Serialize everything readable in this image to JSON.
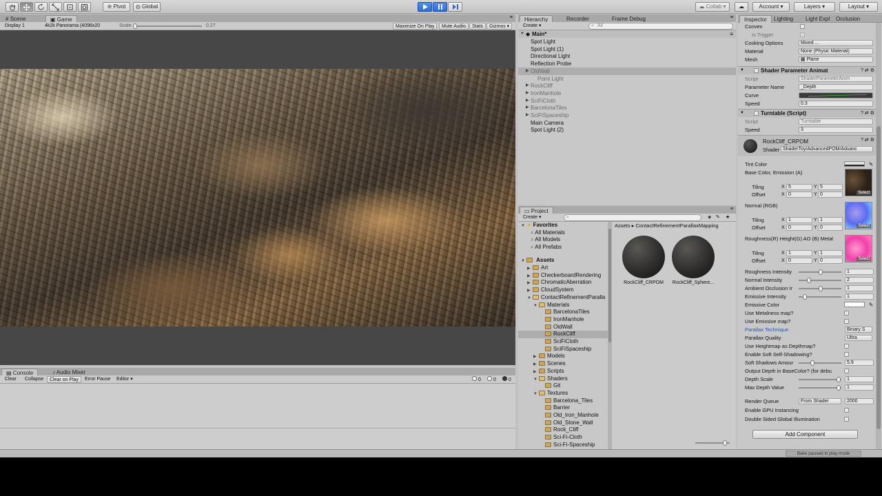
{
  "toolbar": {
    "pivot": "Pivot",
    "global": "Global",
    "collab": "Collab ▾",
    "account": "Account ▾",
    "layers": "Layers ▾",
    "layout": "Layout ▾"
  },
  "viewtabs": {
    "scene": "Scene",
    "game": "Game"
  },
  "gamebar": {
    "display": "Display 1",
    "resolution": "4k2k Panorama (4096x20",
    "scale_label": "Scale",
    "scale_value": "0.27",
    "maximize": "Maximize On Play",
    "mute": "Mute Audio",
    "stats": "Stats",
    "gizmos": "Gizmos ▾"
  },
  "console": {
    "tab_console": "Console",
    "tab_mixer": "Audio Mixer",
    "clear": "Clear",
    "collapse": "Collapse",
    "clear_on_play": "Clear on Play",
    "error_pause": "Error Pause",
    "editor": "Editor ▾",
    "count_log": "0",
    "count_warn": "0",
    "count_err": "0"
  },
  "hierarchy": {
    "tabs": [
      "Hierarchy",
      "Recorder (expe",
      "Frame Debug"
    ],
    "create": "Create ▾",
    "search_placeholder": "All",
    "scene_name": "Main*",
    "items": [
      {
        "label": "Spot Light",
        "indent": 0,
        "arrow": false,
        "dim": false,
        "selected": false
      },
      {
        "label": "Spot Light (1)",
        "indent": 0,
        "arrow": false,
        "dim": false,
        "selected": false
      },
      {
        "label": "Directional Light",
        "indent": 0,
        "arrow": false,
        "dim": false,
        "selected": false
      },
      {
        "label": "Reflection Probe",
        "indent": 0,
        "arrow": false,
        "dim": false,
        "selected": false
      },
      {
        "label": "OldWall",
        "indent": 0,
        "arrow": true,
        "dim": true,
        "selected": true
      },
      {
        "label": "Point Light",
        "indent": 1,
        "arrow": false,
        "dim": true,
        "selected": false
      },
      {
        "label": "RockCliff",
        "indent": 0,
        "arrow": true,
        "dim": true,
        "selected": false
      },
      {
        "label": "IronManhole",
        "indent": 0,
        "arrow": true,
        "dim": true,
        "selected": false
      },
      {
        "label": "SciFiCloth",
        "indent": 0,
        "arrow": true,
        "dim": true,
        "selected": false
      },
      {
        "label": "BarcelonaTiles",
        "indent": 0,
        "arrow": true,
        "dim": true,
        "selected": false
      },
      {
        "label": "SciFiSpaceship",
        "indent": 0,
        "arrow": true,
        "dim": true,
        "selected": false
      },
      {
        "label": "Main Camera",
        "indent": 0,
        "arrow": false,
        "dim": false,
        "selected": false
      },
      {
        "label": "Spot Light (2)",
        "indent": 0,
        "arrow": false,
        "dim": false,
        "selected": false
      }
    ]
  },
  "project": {
    "tab": "Project",
    "create": "Create ▾",
    "breadcrumb_root": "Assets",
    "breadcrumb_sep": "▸",
    "breadcrumb_leaf": "ContactRefinementParallaxMapping",
    "favorites_label": "Favorites",
    "favorites": [
      "All Materials",
      "All Models",
      "All Prefabs"
    ],
    "assets_label": "Assets",
    "tree": [
      {
        "label": "Art",
        "level": 1,
        "open": false,
        "selected": false
      },
      {
        "label": "CheckerboardRendering",
        "level": 1,
        "open": false,
        "selected": false
      },
      {
        "label": "ChromaticAberration",
        "level": 1,
        "open": false,
        "selected": false
      },
      {
        "label": "CloudSystem",
        "level": 1,
        "open": false,
        "selected": false
      },
      {
        "label": "ContactRefinementParalla",
        "level": 1,
        "open": true,
        "selected": false
      },
      {
        "label": "Materials",
        "level": 2,
        "open": true,
        "selected": false
      },
      {
        "label": "BarcelonaTiles",
        "level": 3,
        "open": false,
        "selected": false
      },
      {
        "label": "IronManhole",
        "level": 3,
        "open": false,
        "selected": false
      },
      {
        "label": "OldWall",
        "level": 3,
        "open": false,
        "selected": false
      },
      {
        "label": "RockCliff",
        "level": 3,
        "open": false,
        "selected": true
      },
      {
        "label": "SciFiCloth",
        "level": 3,
        "open": false,
        "selected": false
      },
      {
        "label": "SciFiSpaceship",
        "level": 3,
        "open": false,
        "selected": false
      },
      {
        "label": "Models",
        "level": 2,
        "open": false,
        "selected": false
      },
      {
        "label": "Scenes",
        "level": 2,
        "open": false,
        "selected": false
      },
      {
        "label": "Scripts",
        "level": 2,
        "open": false,
        "selected": false
      },
      {
        "label": "Shaders",
        "level": 2,
        "open": true,
        "selected": false
      },
      {
        "label": "Git",
        "level": 3,
        "open": false,
        "selected": false
      },
      {
        "label": "Textures",
        "level": 2,
        "open": true,
        "selected": false
      },
      {
        "label": "Barcelona_Tiles",
        "level": 3,
        "open": false,
        "selected": false
      },
      {
        "label": "Barrier",
        "level": 3,
        "open": false,
        "selected": false
      },
      {
        "label": "Old_Iron_Manhole",
        "level": 3,
        "open": false,
        "selected": false
      },
      {
        "label": "Old_Stone_Wall",
        "level": 3,
        "open": false,
        "selected": false
      },
      {
        "label": "Rock_Cliff",
        "level": 3,
        "open": false,
        "selected": false
      },
      {
        "label": "Sci-Fi-Cloth",
        "level": 3,
        "open": false,
        "selected": false
      },
      {
        "label": "Sci-Fi-Spaceship",
        "level": 3,
        "open": false,
        "selected": false
      }
    ],
    "assets": [
      "RockCliff_CRPOM",
      "RockCliff_Sphere..."
    ]
  },
  "inspector": {
    "tabs": [
      "Inspector",
      "Lighting",
      "Light Expl",
      "Occlusion"
    ],
    "convex": "Convex",
    "is_trigger": "Is Trigger",
    "cooking_options": "Cooking Options",
    "cooking_value": "Mixed ...",
    "material": "Material",
    "material_value": "None (Physic Material)",
    "mesh": "Mesh",
    "mesh_value": "Plane",
    "spa_title": "Shader Parameter Animat",
    "script_label": "Script",
    "spa_script": "ShaderParameterAnim",
    "param_name_label": "Parameter Name",
    "param_name_value": "_Depth",
    "curve_label": "Curve",
    "speed_label": "Speed",
    "spa_speed": "0.3",
    "turntable_title": "Turntable (Script)",
    "turntable_script": "Turntable",
    "turntable_speed": "3",
    "material_name": "RockCliff_CRPOM",
    "shader_label": "Shader",
    "shader_value": "ShaderToy/AdvancedPOM/Advanc",
    "tint_color": "Tint Color",
    "base_color": "Base Color, Emission (A)",
    "tiling": "Tiling",
    "offset": "Offset",
    "x_label": "X",
    "y_label": "Y",
    "base_tiling_x": "5",
    "base_tiling_y": "5",
    "base_offset_x": "0",
    "base_offset_y": "0",
    "select_label": "Select",
    "normal_label": "Normal (RGB)",
    "normal_tiling_x": "1",
    "normal_tiling_y": "1",
    "normal_offset_x": "0",
    "normal_offset_y": "0",
    "rough_label": "Roughness(R) Height(G) AO (B) Metal",
    "rough_tiling_x": "1",
    "rough_tiling_y": "1",
    "rough_offset_x": "0",
    "rough_offset_y": "0",
    "props": [
      {
        "label": "Roughness Intensity",
        "kind": "slider",
        "value": "1",
        "pos": 0.5
      },
      {
        "label": "Normal Intensity",
        "kind": "slider",
        "value": "2",
        "pos": 0.2
      },
      {
        "label": "Ambient Occlusion Ir",
        "kind": "slider",
        "value": "1",
        "pos": 0.5
      },
      {
        "label": "Emissive Intensity",
        "kind": "slider",
        "value": "1",
        "pos": 0.1
      },
      {
        "label": "Emissive Color",
        "kind": "color",
        "value": ""
      },
      {
        "label": "Use Metalness map?",
        "kind": "check",
        "value": ""
      },
      {
        "label": "Use Emissive map?",
        "kind": "check",
        "value": ""
      },
      {
        "label": "Parallax Technique",
        "kind": "dropdown",
        "value": "Binary S",
        "blue": true
      },
      {
        "label": "Parallax Quality",
        "kind": "dropdown",
        "value": "Ultra",
        "blue": false
      },
      {
        "label": "Use Heightmap as Depthmap?",
        "kind": "check",
        "value": ""
      },
      {
        "label": "Enable Soft Self-Shadowing?",
        "kind": "check",
        "value": ""
      },
      {
        "label": "Soft Shadows Amour",
        "kind": "slider",
        "value": "5.9",
        "pos": 0.3
      },
      {
        "label": "Output Depth in BaseColor? (for debu",
        "kind": "check",
        "value": ""
      },
      {
        "label": "Depth Scale",
        "kind": "slider",
        "value": "1",
        "pos": 0.95
      },
      {
        "label": "Max Depth Value",
        "kind": "slider",
        "value": "1",
        "pos": 0.95
      }
    ],
    "render_queue": "Render Queue",
    "render_queue_mode": "From Shader",
    "render_queue_value": "2000",
    "gpu_instancing": "Enable GPU Instancing",
    "double_sided": "Double Sided Global Illumination",
    "add_component": "Add Component"
  },
  "status": {
    "bake": "Bake paused in play mode"
  },
  "colors": {
    "play_blue": "#2b6fd6",
    "selection": "#adadad",
    "link_blue": "#2754b8"
  }
}
